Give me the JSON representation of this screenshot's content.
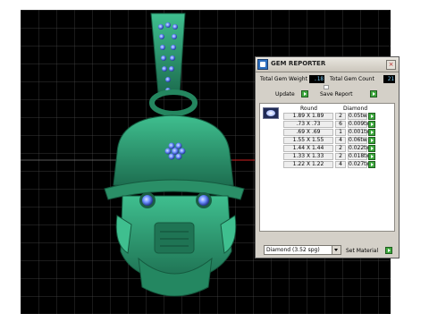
{
  "panel": {
    "title": "GEM REPORTER",
    "close_glyph": "×",
    "total_weight_label": "Total Gem Weight",
    "total_weight_value": ".18",
    "total_count_label": "Total Gem Count",
    "total_count_value": "21",
    "update_label": "Update",
    "save_label": "Save Report",
    "columns": {
      "shape": "Round",
      "material": "Diamond"
    },
    "rows": [
      {
        "size": "1.89 X 1.89",
        "count": "2",
        "weight": "0.05tw"
      },
      {
        "size": ".73 X .73",
        "count": "6",
        "weight": "0.009tw"
      },
      {
        "size": ".69 X .69",
        "count": "1",
        "weight": "0.001tw"
      },
      {
        "size": "1.55 X 1.55",
        "count": "4",
        "weight": "0.06tw"
      },
      {
        "size": "1.44 X 1.44",
        "count": "2",
        "weight": "0.022tw"
      },
      {
        "size": "1.33 X 1.33",
        "count": "2",
        "weight": "0.018tw"
      },
      {
        "size": "1.22 X 1.22",
        "count": "4",
        "weight": "0.027tw"
      }
    ],
    "material_value": "Diamond     (3.52 spg)",
    "set_material_label": "Set Material"
  },
  "icons": {
    "logo": "gem-reporter-logo-icon",
    "go": "green-arrow-icon",
    "thumb": "round-gem-icon"
  },
  "colors": {
    "viewport_bg": "#000000",
    "grid": "#5a5a5a",
    "model": "#2e9a72",
    "gem": "#4f7cff",
    "panel_bg": "#d4d0c8",
    "value_text": "#7dd3ff"
  }
}
